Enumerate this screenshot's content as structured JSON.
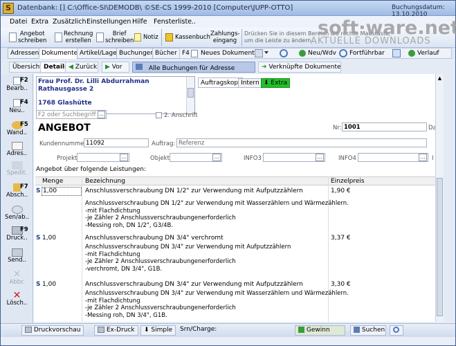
{
  "window": {
    "title": "Datenbank: [] C:\\Office-SI\\DEMODB\\ ©SE-CS 1999-2010 [Computer\\JUPP-OTTO]",
    "date_text": "Buchungsdatum: 13.10.2010"
  },
  "menu": [
    "Datei",
    "Extra",
    "Zusätzlich",
    "Einstellungen",
    "Hilfe",
    "Fensterliste.."
  ],
  "toolbar": {
    "angebot": "Angebot\nschreiben",
    "rechnung": "Rechnung\nerstellen",
    "brief": "Brief\nschreiben",
    "notiz": "Notiz",
    "kassenbuch": "Kassenbuch",
    "zahlung": "Zahlungs-\neingang",
    "hint": "Drücken Sie in diesem Bereich die rechte Maustaste,\num die Leiste zu ändern."
  },
  "tabs": [
    "Adressen",
    "Dokumente",
    "Artikel/Lager",
    "Buchungen",
    "Bücher"
  ],
  "tabs_right": {
    "f4": "F4",
    "neues_dokument": "Neues Dokument",
    "neu_wdv": "Neu/Wdv",
    "fortfuehrbar": "Fortführbar",
    "verlauf": "Verlauf"
  },
  "subtabs": {
    "uebersicht": "Übersicht",
    "details": "Details",
    "zurueck": "Zurück",
    "vor": "Vor",
    "alle_buchungen": "Alle Buchungen für Adresse",
    "verknuepfte": "Verknüpfte Dokumente"
  },
  "leftbar": [
    {
      "key": "F2",
      "label": "Bearb.."
    },
    {
      "key": "F4",
      "label": "Neu.."
    },
    {
      "key": "F5",
      "label": "Wand.."
    },
    {
      "key": "",
      "label": "Adres.."
    },
    {
      "key": "",
      "label": "Spedit."
    },
    {
      "key": "F7",
      "label": "Absch.."
    },
    {
      "key": "",
      "label": "Sen/ab.."
    },
    {
      "key": "F9",
      "label": "Druck.."
    },
    {
      "key": "",
      "label": "Send.."
    },
    {
      "key": "",
      "label": "Abbr."
    },
    {
      "key": "",
      "label": "Lösch.."
    }
  ],
  "address": {
    "line1": "Frau Prof. Dr. Lilli Abdurrahman",
    "line2": "Rathausgasse 2",
    "line3": "1768 Glashütte"
  },
  "search": {
    "placeholder": "F2 oder Suchbegriff",
    "anschrift": "2. Anschrift"
  },
  "doc_tabs": {
    "kopf": "Auftragskopf",
    "intern": "Intern",
    "extra": "Extra"
  },
  "doc": {
    "type": "ANGEBOT",
    "nr_label": "Nr:",
    "nr": "1001",
    "da_label": "Da",
    "kundennummer_label": "Kundennummer:",
    "kundennummer": "11092",
    "auftrag_label": "Auftrag:",
    "auftrag": "Referenz",
    "projekt_label": "Projekt",
    "objekt_label": "Objekt",
    "info3_label": "INFO3",
    "info4_label": "INFO4",
    "i_label": "I",
    "intro": "Angebot über folgende Leistungen:"
  },
  "table": {
    "headers": {
      "menge": "Menge",
      "bezeichnung": "Bezeichnung",
      "einzelpreis": "Einzelpreis"
    },
    "rows": [
      {
        "s": "S",
        "menge": "1,00",
        "title": "Anschlussverschraubung DN 1/2\" zur Verwendung mit Aufputzzählern",
        "preis": "1,90 €",
        "desc": "Anschlussverschraubung DN 1/2\" zur Verwendung mit Wasserzählern und Wärmezählern.\n-mit Flachdichtung\n-je Zähler 2 Anschlussverschraubungenerforderlich\n-Messing roh, DN 1/2\", G3/4B."
      },
      {
        "s": "S",
        "menge": "1,00",
        "title": "Anschlussverschraubung DN 3/4\" verchromt",
        "preis": "3,37 €",
        "desc": "Anschlussverschraubung DN 3/4\" zur Verwendung mit Aufputzzählern\n-mit Flachdichtung\n-je Zähler 2 Anschlussverschraubungenerforderlich\n-verchromt, DN 3/4\", G1B."
      },
      {
        "s": "S",
        "menge": "1,00",
        "title": "Anschlussverschraubung DN 3/4\" zur Verwendung mit Aufputzzählern",
        "preis": "3,30 €",
        "desc": "Anschlussverschraubung DN 3/4\" zur Verwendung mit Wasserzählern und Wärmezählern.\n-mit Flachdichtung\n-je Zähler 2 Anschlussverschraubungenerforderlich\n-Messing roh, DN 3/4\", G1B."
      }
    ]
  },
  "statusbar": {
    "druckvorschau": "Druckvorschau",
    "exdruck": "Ex-Druck",
    "simple": "Simple",
    "srn": "Srn/Charge:",
    "gewinn": "Gewinn",
    "suchen": "Suchen"
  },
  "watermark": {
    "brand": "soft·ware.net",
    "sub": "AKTUELLE DOWNLOADS"
  },
  "colors": {
    "accent": "#1f3f87",
    "address_text": "#1f2f8a",
    "extra_tab": "#22c02a",
    "selected_bar": "#b9c8e8"
  }
}
